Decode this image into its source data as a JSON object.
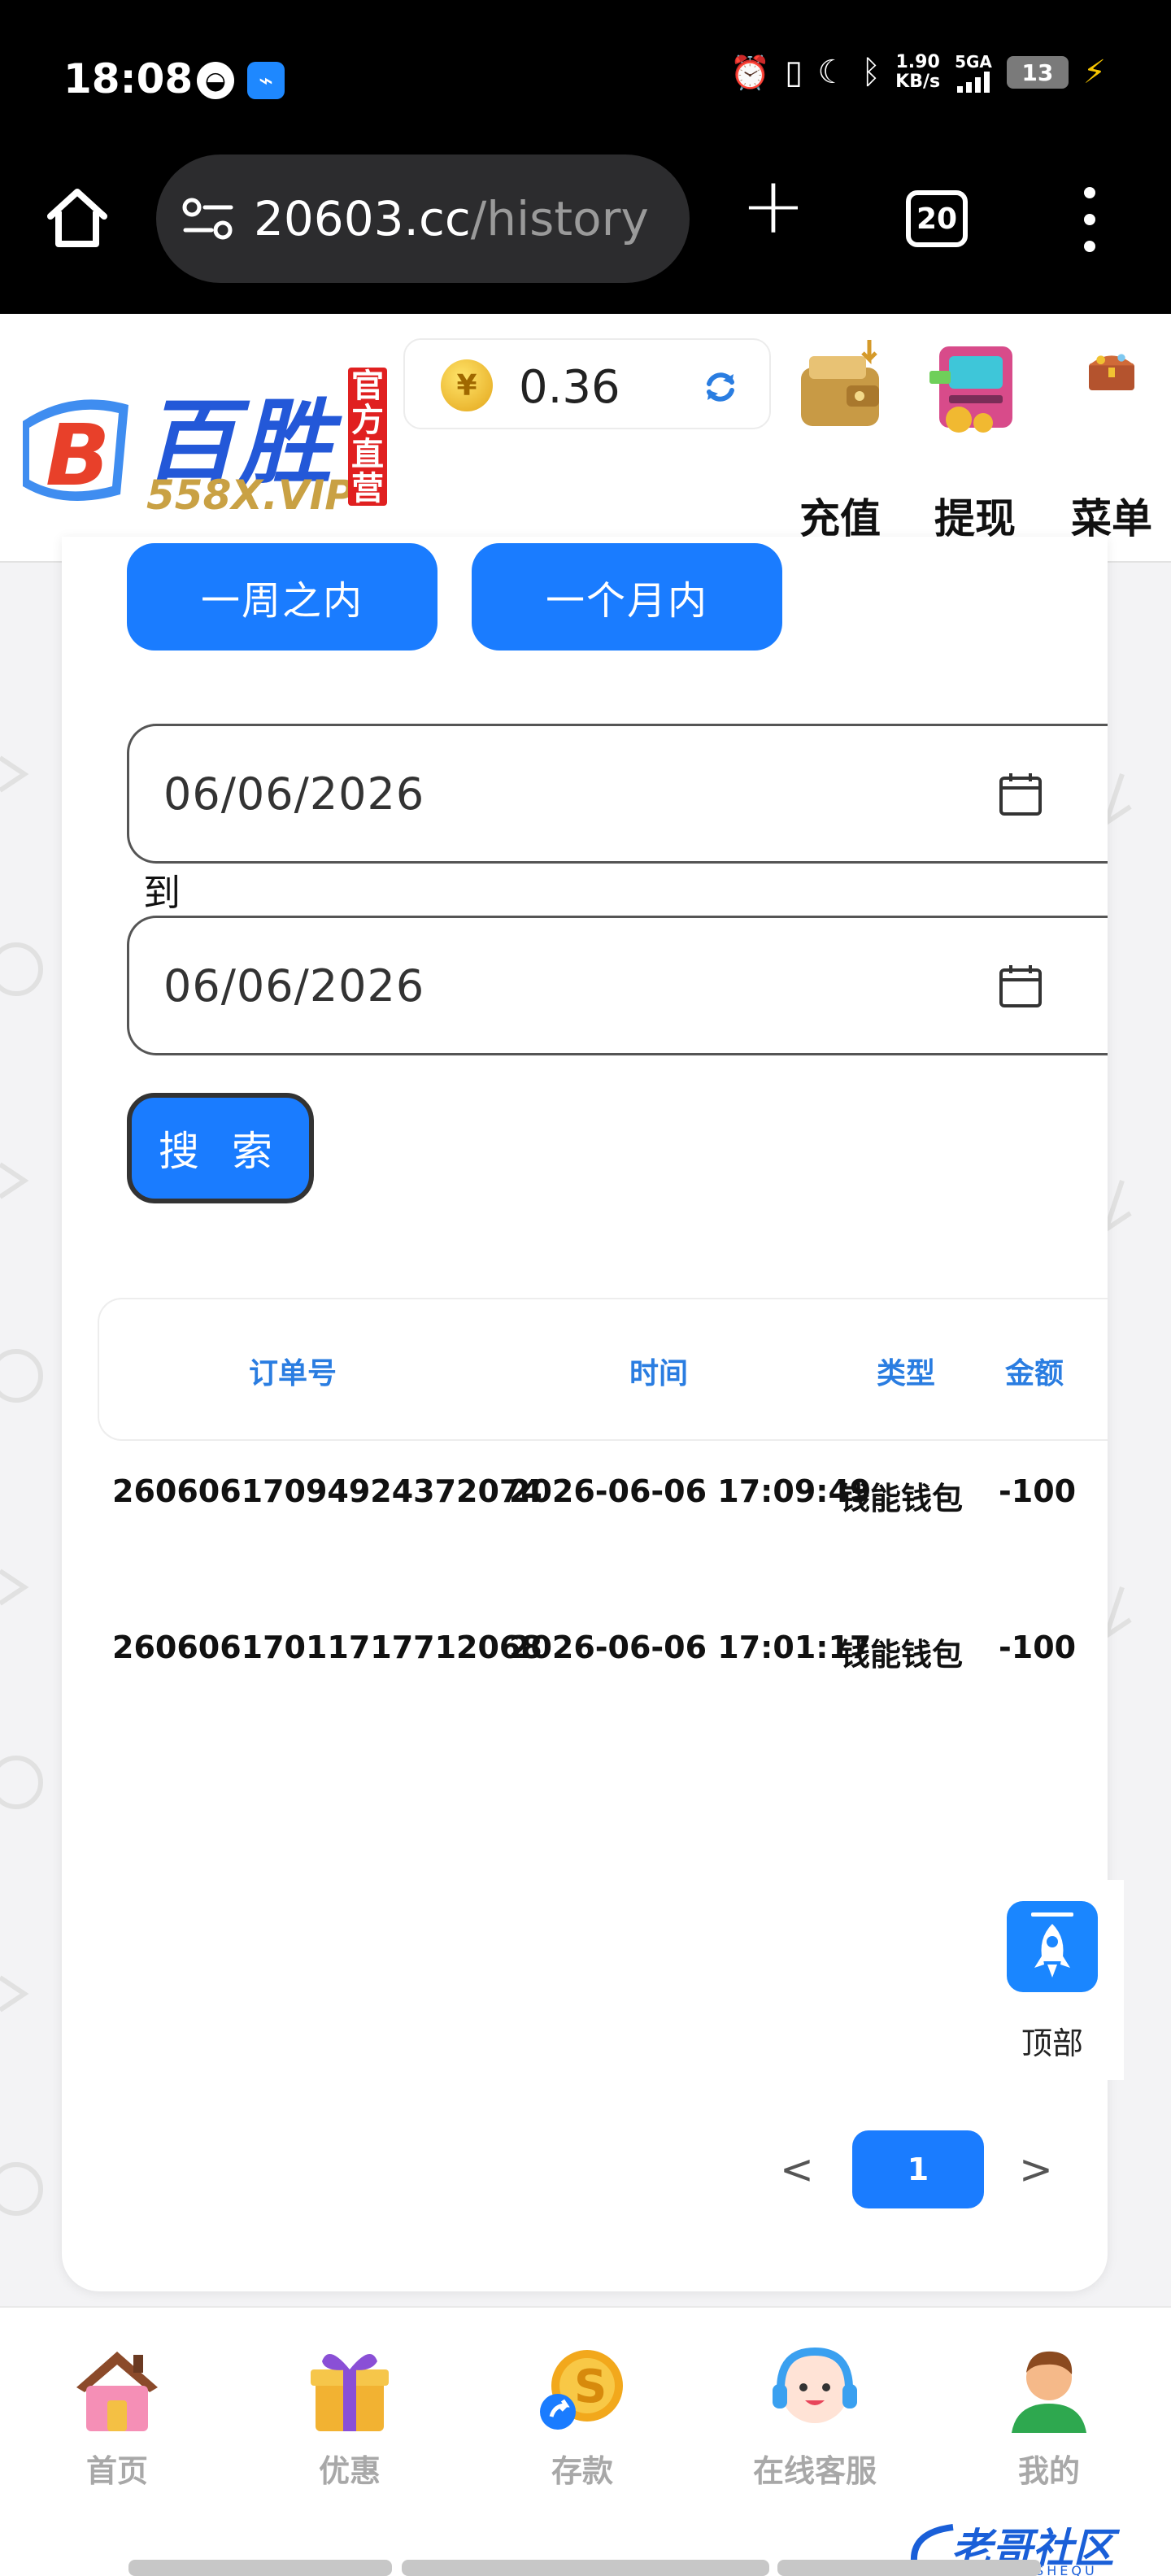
{
  "status_bar": {
    "time": "18:08",
    "speed_value": "1.90",
    "speed_unit": "KB/s",
    "network": "5GA",
    "battery": "13"
  },
  "browser": {
    "url_host": "20603.cc",
    "url_path": "/history",
    "tab_count": "20"
  },
  "header": {
    "logo_name": "百胜",
    "logo_domain": "558X.VIP",
    "logo_stamp": "官方直营",
    "balance": "0.36",
    "currency_symbol": "¥",
    "actions": [
      {
        "label": "充值",
        "icon": "wallet-icon"
      },
      {
        "label": "提现",
        "icon": "atm-icon"
      },
      {
        "label": "菜单",
        "icon": "treasure-chest-icon"
      }
    ]
  },
  "filters": {
    "period_buttons": [
      "一周之内",
      "一个月内"
    ],
    "date_from": "06/06/2026",
    "to_label": "到",
    "date_to": "06/06/2026",
    "search_label": "搜 索"
  },
  "table": {
    "headers": [
      "订单号",
      "时间",
      "类型",
      "金额"
    ],
    "rows": [
      {
        "order_id": "26060617094924372074",
        "time": "2026-06-06 17:09:49",
        "type": "钱能钱包",
        "amount": "-100"
      },
      {
        "order_id": "26060617011717712068",
        "time": "2026-06-06 17:01:17",
        "type": "钱能钱包",
        "amount": "-100"
      }
    ]
  },
  "pagination": {
    "prev": "<",
    "current": "1",
    "next": ">"
  },
  "back_to_top": {
    "label": "顶部"
  },
  "bottom_nav": [
    {
      "label": "首页",
      "icon": "house-icon"
    },
    {
      "label": "优惠",
      "icon": "gift-box-icon"
    },
    {
      "label": "存款",
      "icon": "coin-deposit-icon"
    },
    {
      "label": "在线客服",
      "icon": "support-agent-icon"
    },
    {
      "label": "我的",
      "icon": "user-avatar-icon"
    }
  ],
  "watermark": {
    "text": "老哥社区",
    "sub": "LAOGESHEQU"
  },
  "colors": {
    "accent": "#1a7cff",
    "header_text": "#2a7de1",
    "brand_blue": "#2358d8",
    "gold": "#c9a144",
    "stamp_red": "#e02020"
  }
}
